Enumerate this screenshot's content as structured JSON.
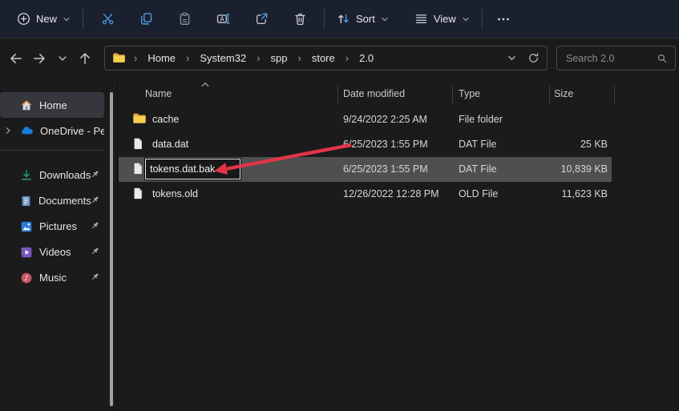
{
  "toolbar": {
    "new_label": "New",
    "sort_label": "Sort",
    "view_label": "View"
  },
  "address": {
    "breadcrumbs": [
      "Home",
      "System32",
      "spp",
      "store",
      "2.0"
    ],
    "search_placeholder": "Search 2.0"
  },
  "sidebar": {
    "items": [
      {
        "label": "Home",
        "selected": true
      },
      {
        "label": "OneDrive - Perso",
        "truncated": true
      },
      {
        "label": "Downloads",
        "pinned": true
      },
      {
        "label": "Documents",
        "pinned": true
      },
      {
        "label": "Pictures",
        "pinned": true
      },
      {
        "label": "Videos",
        "pinned": true
      },
      {
        "label": "Music",
        "pinned": true
      }
    ]
  },
  "list": {
    "columns": {
      "name": "Name",
      "date": "Date modified",
      "type": "Type",
      "size": "Size"
    },
    "sort": "name ascending",
    "rows": [
      {
        "name": "cache",
        "date": "9/24/2022 2:25 AM",
        "type": "File folder",
        "size": "",
        "icon": "folder"
      },
      {
        "name": "data.dat",
        "date": "6/25/2023 1:55 PM",
        "type": "DAT File",
        "size": "25 KB",
        "icon": "file"
      },
      {
        "name": "tokens.dat.bak",
        "date": "6/25/2023 1:55 PM",
        "type": "DAT File",
        "size": "10,839 KB",
        "icon": "file",
        "state": "selected-renaming"
      },
      {
        "name": "tokens.old",
        "date": "12/26/2022 12:28 PM",
        "type": "OLD File",
        "size": "11,623 KB",
        "icon": "file"
      }
    ],
    "rename_value": "tokens.dat.bak"
  },
  "annotation": {
    "type": "red arrow",
    "points_to": "rename text box of tokens.dat.bak"
  },
  "colors": {
    "toolbar_bg": "#1a202d",
    "window_bg": "#1b1b1b",
    "accent_blue": "#4ba0e8",
    "selection_gray": "#4f4f4f",
    "arrow_red": "#e23548",
    "folder_yellow": "#f7ce4e"
  }
}
